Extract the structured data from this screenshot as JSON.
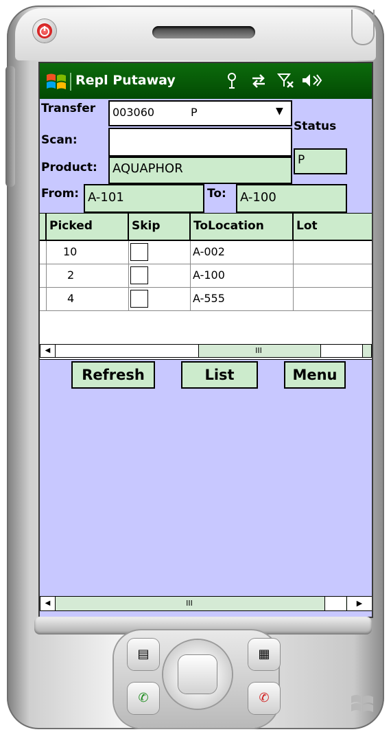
{
  "app_title": "Repl Putaway",
  "status_icons": [
    "connectivity-icon",
    "sync-icon",
    "signal-off-icon",
    "speaker-icon"
  ],
  "form": {
    "transfer_label": "Transfer",
    "transfer_value": "003060",
    "transfer_status_code": "P",
    "scan_label": "Scan:",
    "scan_value": "",
    "status_label": "Status",
    "status_value": "P",
    "product_label": "Product:",
    "product_value": "AQUAPHOR",
    "from_label": "From:",
    "from_value": "A-101",
    "to_label": "To:",
    "to_value": "A-100"
  },
  "grid": {
    "columns": [
      "Picked",
      "Skip",
      "ToLocation",
      "Lot"
    ],
    "rows": [
      {
        "picked": "10",
        "skip": false,
        "to_location": "A-002",
        "lot": ""
      },
      {
        "picked": "2",
        "skip": false,
        "to_location": "A-100",
        "lot": ""
      },
      {
        "picked": "4",
        "skip": false,
        "to_location": "A-555",
        "lot": ""
      }
    ],
    "scroll_thumb_label": "III"
  },
  "buttons": {
    "refresh": "Refresh",
    "list": "List",
    "menu": "Menu"
  },
  "page_scroll_thumb_label": "III",
  "colors": {
    "screen_bg": "#c8c8ff",
    "field_bg": "#ccebcc",
    "title_bar": "#024a02"
  }
}
